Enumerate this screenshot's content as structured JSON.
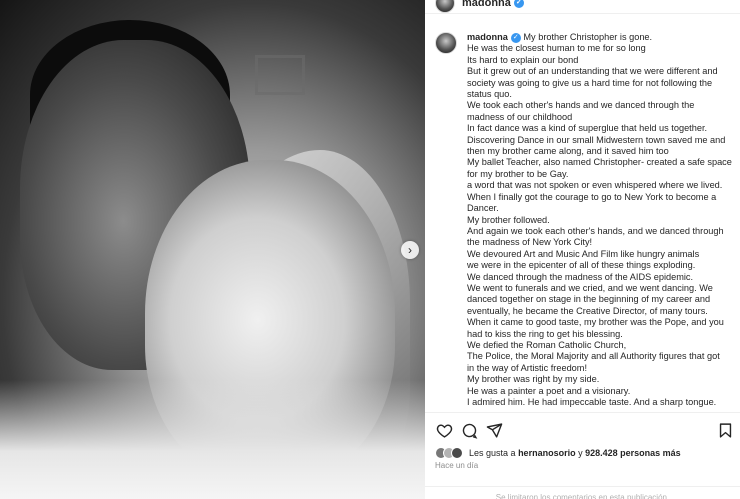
{
  "post": {
    "username": "madonna",
    "verified_icon": "verified-badge-icon",
    "caption_lines": [
      "My brother Christopher is gone.",
      "He was the closest human to me for so long",
      "Its hard to explain our bond",
      "But it grew out of an understanding that we were different and",
      "society was going to give us a hard time for not following the",
      "status quo.",
      "We took each other's hands and we danced through the",
      "madness of our childhood",
      "In fact dance was a kind of superglue that held us together.",
      "Discovering Dance in our small Midwestern town saved me and",
      "then my brother came along, and it saved him too",
      "My ballet Teacher, also named Christopher- created a safe space",
      "for my brother to be Gay.",
      "a word that was not spoken or even whispered where we lived.",
      "When I finally got the courage to go to New York to become a",
      "Dancer.",
      "My brother followed.",
      "And again we took each other's hands, and we danced through",
      "the madness of New York City!",
      "We devoured Art and Music And Film like hungry animals",
      "we were in the epicenter of all of these things exploding.",
      "We danced through the madness of the AIDS epidemic.",
      "We went to funerals and we cried, and we went dancing. We",
      "danced together on stage in the beginning of my career and",
      "eventually, he became the Creative Director, of many tours.",
      "When it came to good taste, my brother was the Pope, and you",
      "had to kiss the ring to get his blessing.",
      "We defied the Roman Catholic Church,",
      "The Police, the Moral Majority and all Authority figures that got",
      "in the way of Artistic freedom!",
      "My brother was right by my side.",
      "He was a painter a poet and a visionary.",
      "I admired him. He had impeccable taste. And a sharp tongue."
    ],
    "likes": {
      "prefix": "Les gusta a",
      "user": "hernanosorio",
      "connector": "y",
      "count": "928.428 personas más"
    },
    "timestamp": "Hace un día",
    "comments_notice": "Se limitaron los comentarios en esta publicación."
  },
  "icons": {
    "like": "heart-icon",
    "comment": "comment-icon",
    "share": "share-icon",
    "save": "bookmark-icon",
    "next": "chevron-right-icon"
  },
  "colors": {
    "verified": "#3897f0",
    "text": "#262626",
    "muted": "#8e8e8e"
  }
}
